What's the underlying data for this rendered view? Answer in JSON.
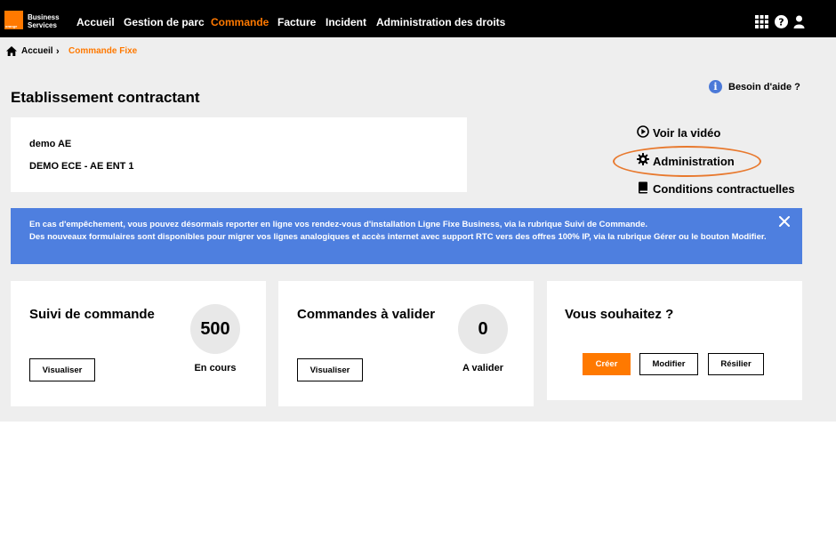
{
  "header": {
    "logo_small": "orange",
    "brand_line1": "Business",
    "brand_line2": "Services",
    "nav": [
      {
        "label": "Accueil"
      },
      {
        "label": "Gestion de parc"
      },
      {
        "label": "Commande"
      },
      {
        "label": "Facture"
      },
      {
        "label": "Incident"
      },
      {
        "label": "Administration des droits"
      }
    ],
    "accent_color": "#ff7900",
    "icons": [
      "grid-icon",
      "help-circle-icon",
      "user-icon"
    ]
  },
  "breadcrumb": {
    "home": "Accueil",
    "current": "Commande Fixe"
  },
  "page": {
    "title": "Etablissement contractant",
    "help_label": "Besoin d'aide ?"
  },
  "contract": {
    "line1": "demo AE",
    "line2": "DEMO ECE - AE ENT 1"
  },
  "side_links": {
    "video": "Voir la vidéo",
    "admin": "Administration",
    "conditions": "Conditions contractuelles"
  },
  "banner": {
    "line1": "En cas d'empêchement, vous pouvez désormais reporter en ligne vos rendez-vous d'installation Ligne Fixe Business, via la rubrique Suivi de Commande.",
    "line2": "Des nouveaux formulaires sont disponibles pour migrer vos lignes analogiques et accès internet avec support RTC vers des offres 100% IP, via la rubrique Gérer ou le bouton Modifier.",
    "color": "#4e7fdf"
  },
  "cards": {
    "suivi": {
      "title": "Suivi de commande",
      "count": "500",
      "count_label": "En cours",
      "button": "Visualiser"
    },
    "valider": {
      "title": "Commandes à valider",
      "count": "0",
      "count_label": "A valider",
      "button": "Visualiser"
    },
    "souhaitez": {
      "title": "Vous souhaitez ?",
      "create": "Créer",
      "modify": "Modifier",
      "cancel": "Résilier"
    }
  }
}
